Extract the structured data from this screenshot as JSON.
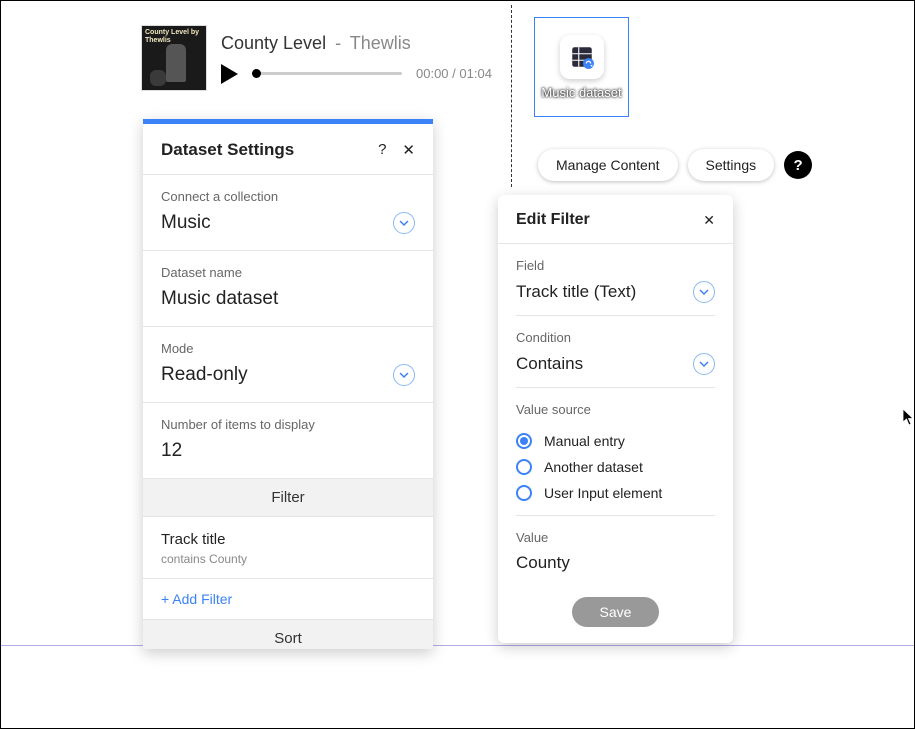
{
  "audio": {
    "title": "County Level",
    "artist": "Thewlis",
    "album_text": "County Level by Thewlis",
    "current_time": "00:00",
    "total_time": "01:04"
  },
  "dataset_node": {
    "label": "Music dataset"
  },
  "actions": {
    "manage_content": "Manage Content",
    "settings": "Settings"
  },
  "settings_panel": {
    "title": "Dataset Settings",
    "collection_label": "Connect a collection",
    "collection_value": "Music",
    "name_label": "Dataset name",
    "name_value": "Music dataset",
    "mode_label": "Mode",
    "mode_value": "Read-only",
    "items_label": "Number of items to display",
    "items_value": "12",
    "filter_header": "Filter",
    "filter_item_title": "Track title",
    "filter_item_desc": "contains County",
    "add_filter": "+ Add Filter",
    "sort_header": "Sort"
  },
  "filter_panel": {
    "title": "Edit Filter",
    "field_label": "Field",
    "field_value": "Track title (Text)",
    "condition_label": "Condition",
    "condition_value": "Contains",
    "value_source_label": "Value source",
    "options": {
      "manual": "Manual entry",
      "another": "Another dataset",
      "user_input": "User Input element"
    },
    "value_label": "Value",
    "value_value": "County",
    "save": "Save"
  }
}
